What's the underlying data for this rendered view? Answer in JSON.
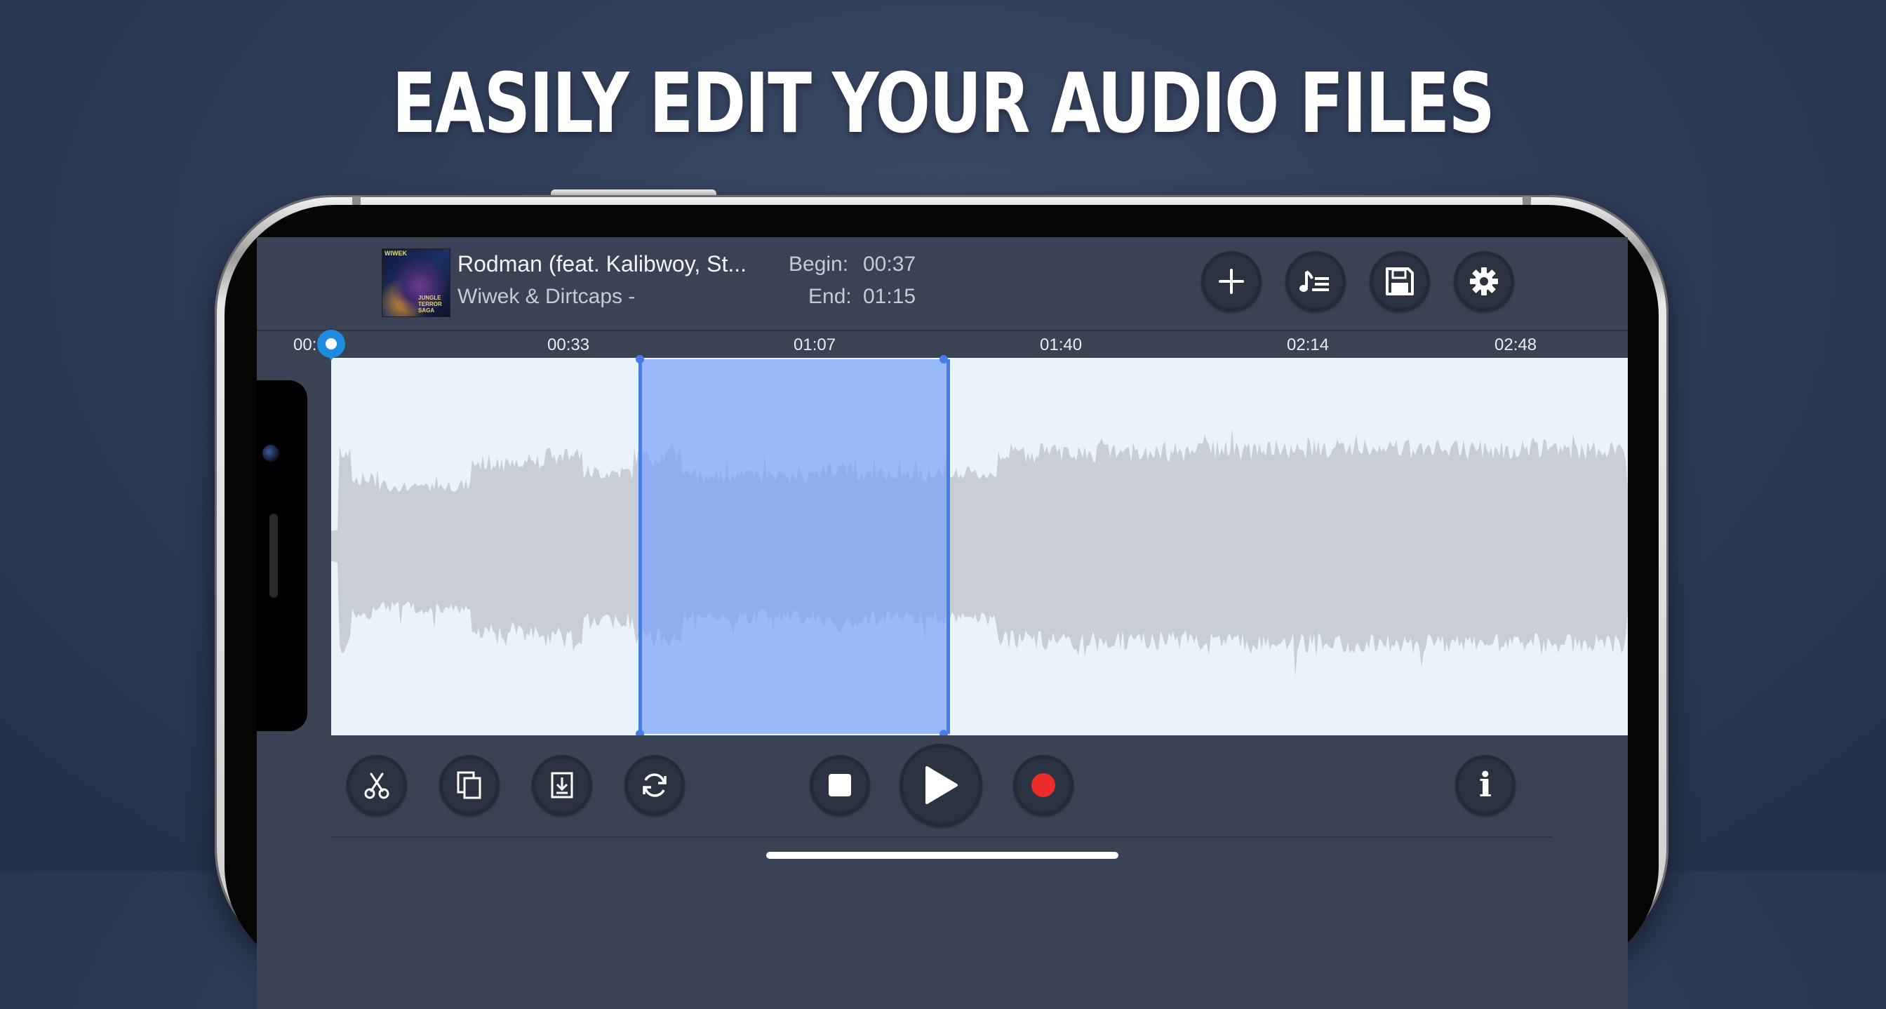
{
  "headline": "EASILY EDIT YOUR AUDIO FILES",
  "track": {
    "album_art_top_text": "WIWEK",
    "album_art_bottom_text": "JUNGLE TERROR SAGA",
    "title": "Rodman (feat. Kalibwoy, St...",
    "artist": "Wiwek & Dirtcaps -",
    "begin_label": "Begin:",
    "begin_value": "00:37",
    "end_label": "End:",
    "end_value": "01:15"
  },
  "toolbar_top": [
    {
      "name": "add-button",
      "icon": "plus-icon"
    },
    {
      "name": "playlist-button",
      "icon": "music-list-icon"
    },
    {
      "name": "save-button",
      "icon": "floppy-disk-icon"
    },
    {
      "name": "settings-button",
      "icon": "gear-icon"
    }
  ],
  "timeline": {
    "ticks": [
      "00:",
      "00:33",
      "01:07",
      "01:40",
      "02:14",
      "02:48"
    ],
    "selection_begin": "00:37",
    "selection_end": "01:15"
  },
  "toolbar_bottom": {
    "edit": [
      {
        "name": "cut-button",
        "icon": "scissors-icon"
      },
      {
        "name": "copy-button",
        "icon": "copy-icon"
      },
      {
        "name": "paste-button",
        "icon": "paste-download-icon"
      },
      {
        "name": "loop-button",
        "icon": "refresh-icon"
      }
    ],
    "transport": [
      {
        "name": "stop-button",
        "icon": "stop-icon"
      },
      {
        "name": "play-button",
        "icon": "play-icon"
      },
      {
        "name": "record-button",
        "icon": "record-icon"
      }
    ],
    "info": {
      "name": "info-button",
      "icon": "info-icon",
      "label": "i"
    }
  },
  "colors": {
    "waveform_bg": "#e8f3fc",
    "waveform": "#c9ced6",
    "selection": "#7aa2fa",
    "selection_handle": "#4a7ce8",
    "playhead": "#1e8de0",
    "record": "#ee2b2b"
  }
}
